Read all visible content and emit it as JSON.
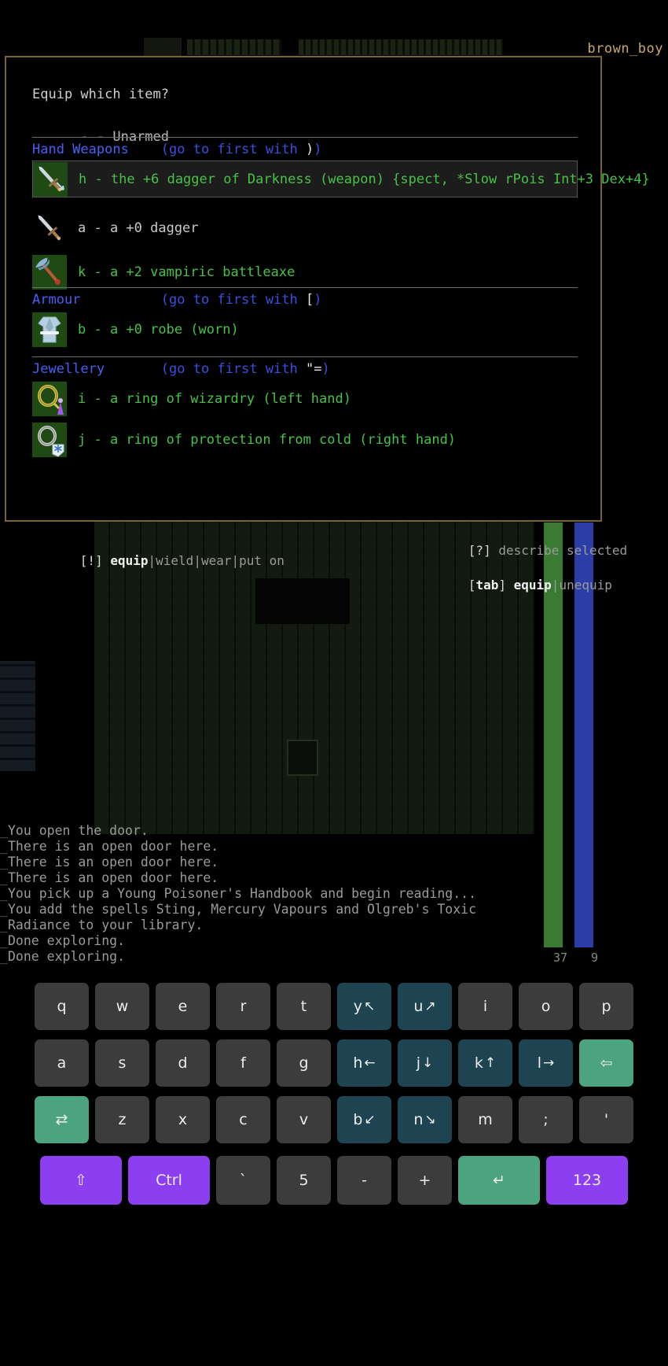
{
  "game": {
    "player_name": "brown_boy",
    "hp": "37",
    "mp": "9",
    "log": [
      "You open the door.",
      "There is an open door here.",
      "There is an open door here.",
      "There is an open door here.",
      "You pick up a Young Poisoner's Handbook and begin reading...",
      "You add the spells Sting, Mercury Vapours and Olgreb's Toxic",
      "Radiance to your library.",
      "Done exploring.",
      "Done exploring."
    ]
  },
  "menu": {
    "title": "Equip which item?",
    "unarmed": "- - Unarmed",
    "categories": [
      {
        "name": "Hand Weapons",
        "hint_pre": "(go to first with ",
        "hint_key": ")",
        "hint_post": ")",
        "items": [
          {
            "letter": "h",
            "label": "h - the +6 dagger of Darkness (weapon) {spect, *Slow rPois Int+3 Dex+4}",
            "selected": true,
            "icon": "dagger-of-darkness-icon",
            "color": "green"
          },
          {
            "letter": "a",
            "label": "a - a +0 dagger",
            "selected": false,
            "icon": "dagger-icon",
            "color": "grey"
          },
          {
            "letter": "k",
            "label": "k - a +2 vampiric battleaxe",
            "selected": false,
            "icon": "battleaxe-icon",
            "color": "green"
          }
        ]
      },
      {
        "name": "Armour",
        "hint_pre": "(go to first with ",
        "hint_key": "[",
        "hint_post": ")",
        "items": [
          {
            "letter": "b",
            "label": "b - a +0 robe (worn)",
            "selected": false,
            "icon": "robe-icon",
            "color": "green"
          }
        ]
      },
      {
        "name": "Jewellery",
        "hint_pre": "(go to first with ",
        "hint_key": "\"=",
        "hint_post": ")",
        "items": [
          {
            "letter": "i",
            "label": "i - a ring of wizardry (left hand)",
            "selected": false,
            "icon": "ring-of-wizardry-icon",
            "color": "green"
          },
          {
            "letter": "j",
            "label": "j - a ring of protection from cold (right hand)",
            "selected": false,
            "icon": "ring-of-cold-protection-icon",
            "color": "green"
          }
        ]
      }
    ],
    "footer_left": {
      "bracket": "[!]",
      "bold": "equip",
      "rest": "|wield|wear|put on"
    },
    "footer_right_1": {
      "bracket": "[?]",
      "rest": " describe selected"
    },
    "footer_right_2": {
      "bracket_open": "[",
      "bold_key": "tab",
      "bracket_close": "]",
      "bold": "equip",
      "rest": "|unequip"
    }
  },
  "keyboard": {
    "rows": [
      [
        {
          "label": "q",
          "arrow": "",
          "style": "grey"
        },
        {
          "label": "w",
          "arrow": "",
          "style": "grey"
        },
        {
          "label": "e",
          "arrow": "",
          "style": "grey"
        },
        {
          "label": "r",
          "arrow": "",
          "style": "grey"
        },
        {
          "label": "t",
          "arrow": "",
          "style": "grey"
        },
        {
          "label": "y",
          "arrow": "↖",
          "style": "teal"
        },
        {
          "label": "u",
          "arrow": "↗",
          "style": "teal"
        },
        {
          "label": "i",
          "arrow": "",
          "style": "grey"
        },
        {
          "label": "o",
          "arrow": "",
          "style": "grey"
        },
        {
          "label": "p",
          "arrow": "",
          "style": "grey"
        }
      ],
      [
        {
          "label": "a",
          "arrow": "",
          "style": "grey"
        },
        {
          "label": "s",
          "arrow": "",
          "style": "grey"
        },
        {
          "label": "d",
          "arrow": "",
          "style": "grey"
        },
        {
          "label": "f",
          "arrow": "",
          "style": "grey"
        },
        {
          "label": "g",
          "arrow": "",
          "style": "grey"
        },
        {
          "label": "h",
          "arrow": "←",
          "style": "teal"
        },
        {
          "label": "j",
          "arrow": "↓",
          "style": "teal"
        },
        {
          "label": "k",
          "arrow": "↑",
          "style": "teal"
        },
        {
          "label": "l",
          "arrow": "→",
          "style": "teal"
        },
        {
          "label": "⇦",
          "arrow": "",
          "style": "green"
        }
      ],
      [
        {
          "label": "⇄",
          "arrow": "",
          "style": "green"
        },
        {
          "label": "z",
          "arrow": "",
          "style": "grey"
        },
        {
          "label": "x",
          "arrow": "",
          "style": "grey"
        },
        {
          "label": "c",
          "arrow": "",
          "style": "grey"
        },
        {
          "label": "v",
          "arrow": "",
          "style": "grey"
        },
        {
          "label": "b",
          "arrow": "↙",
          "style": "teal"
        },
        {
          "label": "n",
          "arrow": "↘",
          "style": "teal"
        },
        {
          "label": "m",
          "arrow": "",
          "style": "grey"
        },
        {
          "label": ";",
          "arrow": "",
          "style": "grey"
        },
        {
          "label": "'",
          "arrow": "",
          "style": "grey"
        }
      ],
      [
        {
          "label": "⇧",
          "arrow": "",
          "style": "purple",
          "wide": true
        },
        {
          "label": "Ctrl",
          "arrow": "",
          "style": "purple",
          "wide": true
        },
        {
          "label": "`",
          "arrow": "",
          "style": "grey"
        },
        {
          "label": "5",
          "arrow": "",
          "style": "grey"
        },
        {
          "label": "-",
          "arrow": "",
          "style": "grey"
        },
        {
          "label": "+",
          "arrow": "",
          "style": "grey"
        },
        {
          "label": "↵",
          "arrow": "",
          "style": "green",
          "wide": true
        },
        {
          "label": "123",
          "arrow": "",
          "style": "purple",
          "wide": true
        }
      ]
    ]
  },
  "colors": {
    "panel_border": "#7a6233",
    "category": "#4a5ff5",
    "item_green": "#46c246",
    "hp": "#3a7a33",
    "mp": "#2b3ea8",
    "key_teal": "#1d4450",
    "key_green": "#4ba47e",
    "key_purple": "#8b3ff0"
  }
}
